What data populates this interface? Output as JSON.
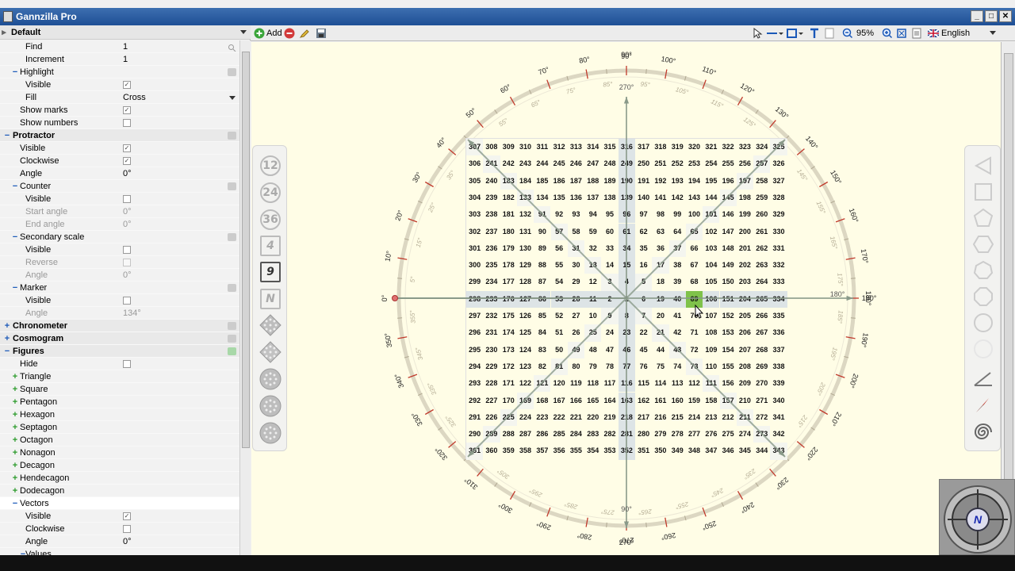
{
  "app": {
    "title": "Gannzilla Pro"
  },
  "profile": {
    "name": "Default"
  },
  "properties": [
    {
      "label": "Find",
      "indent": 2,
      "value": "1",
      "icon": "search"
    },
    {
      "label": "Increment",
      "indent": 2,
      "value": "1"
    },
    {
      "label": "Highlight",
      "indent": 1,
      "toggle": "−",
      "icon": "grid"
    },
    {
      "label": "Visible",
      "indent": 2,
      "check": true
    },
    {
      "label": "Fill",
      "indent": 2,
      "value": "Cross",
      "dropdown": true
    },
    {
      "label": "Show marks",
      "indent": 1,
      "check": true
    },
    {
      "label": "Show numbers",
      "indent": 1,
      "check": false
    },
    {
      "label": "Protractor",
      "indent": 0,
      "toggle": "−",
      "section": true,
      "icon": "protractor"
    },
    {
      "label": "Visible",
      "indent": 1,
      "check": true
    },
    {
      "label": "Clockwise",
      "indent": 1,
      "check": true
    },
    {
      "label": "Angle",
      "indent": 1,
      "value": "0°"
    },
    {
      "label": "Counter",
      "indent": 1,
      "toggle": "−",
      "icon": "counter"
    },
    {
      "label": "Visible",
      "indent": 2,
      "check": false
    },
    {
      "label": "Start angle",
      "indent": 2,
      "value": "0°",
      "dim": true
    },
    {
      "label": "End angle",
      "indent": 2,
      "value": "0°",
      "dim": true
    },
    {
      "label": "Secondary scale",
      "indent": 1,
      "toggle": "−",
      "icon": "scale"
    },
    {
      "label": "Visible",
      "indent": 2,
      "check": false
    },
    {
      "label": "Reverse",
      "indent": 2,
      "check": false,
      "dim": true
    },
    {
      "label": "Angle",
      "indent": 2,
      "value": "0°",
      "dim": true
    },
    {
      "label": "Marker",
      "indent": 1,
      "toggle": "−",
      "icon": "marker"
    },
    {
      "label": "Visible",
      "indent": 2,
      "check": false
    },
    {
      "label": "Angle",
      "indent": 2,
      "value": "134°",
      "dim": true
    },
    {
      "label": "Chronometer",
      "indent": 0,
      "toggle": "+",
      "section": true,
      "icon": "clock"
    },
    {
      "label": "Cosmogram",
      "indent": 0,
      "toggle": "+",
      "section": true,
      "icon": "star"
    },
    {
      "label": "Figures",
      "indent": 0,
      "toggle": "−",
      "section": true,
      "icon": "figures"
    },
    {
      "label": "Hide",
      "indent": 1,
      "check": false
    },
    {
      "label": "Triangle",
      "indent": 1,
      "toggle": "+",
      "green": true
    },
    {
      "label": "Square",
      "indent": 1,
      "toggle": "+",
      "green": true
    },
    {
      "label": "Pentagon",
      "indent": 1,
      "toggle": "+",
      "green": true
    },
    {
      "label": "Hexagon",
      "indent": 1,
      "toggle": "+",
      "green": true
    },
    {
      "label": "Septagon",
      "indent": 1,
      "toggle": "+",
      "green": true
    },
    {
      "label": "Octagon",
      "indent": 1,
      "toggle": "+",
      "green": true
    },
    {
      "label": "Nonagon",
      "indent": 1,
      "toggle": "+",
      "green": true
    },
    {
      "label": "Decagon",
      "indent": 1,
      "toggle": "+",
      "green": true
    },
    {
      "label": "Hendecagon",
      "indent": 1,
      "toggle": "+",
      "green": true
    },
    {
      "label": "Dodecagon",
      "indent": 1,
      "toggle": "+",
      "green": true
    },
    {
      "label": "Vectors",
      "indent": 1,
      "toggle": "−",
      "selected": true
    },
    {
      "label": "Visible",
      "indent": 2,
      "check": true
    },
    {
      "label": "Clockwise",
      "indent": 2,
      "check": false
    },
    {
      "label": "Angle",
      "indent": 2,
      "value": "0°"
    },
    {
      "label": "Values",
      "indent": 2,
      "toggle": "−"
    }
  ],
  "toolbar": {
    "add_label": "Add",
    "zoom": "95%",
    "language": "English"
  },
  "left_tools": {
    "labels": [
      "12",
      "24",
      "36",
      "4",
      "9",
      "N"
    ]
  },
  "square9": {
    "rows": [
      [
        307,
        308,
        309,
        310,
        311,
        312,
        313,
        314,
        315,
        316,
        317,
        318,
        319,
        320,
        321,
        322,
        323,
        324,
        325
      ],
      [
        306,
        241,
        242,
        243,
        244,
        245,
        246,
        247,
        248,
        249,
        250,
        251,
        252,
        253,
        254,
        255,
        256,
        257,
        326
      ],
      [
        305,
        240,
        183,
        184,
        185,
        186,
        187,
        188,
        189,
        190,
        191,
        192,
        193,
        194,
        195,
        196,
        197,
        258,
        327
      ],
      [
        304,
        239,
        182,
        133,
        134,
        135,
        136,
        137,
        138,
        139,
        140,
        141,
        142,
        143,
        144,
        145,
        198,
        259,
        328
      ],
      [
        303,
        238,
        181,
        132,
        91,
        92,
        93,
        94,
        95,
        96,
        97,
        98,
        99,
        100,
        101,
        146,
        199,
        260,
        329
      ],
      [
        302,
        237,
        180,
        131,
        90,
        57,
        58,
        59,
        60,
        61,
        62,
        63,
        64,
        65,
        102,
        147,
        200,
        261,
        330
      ],
      [
        301,
        236,
        179,
        130,
        89,
        56,
        31,
        32,
        33,
        34,
        35,
        36,
        37,
        66,
        103,
        148,
        201,
        262,
        331
      ],
      [
        300,
        235,
        178,
        129,
        88,
        55,
        30,
        13,
        14,
        15,
        16,
        17,
        38,
        67,
        104,
        149,
        202,
        263,
        332
      ],
      [
        299,
        234,
        177,
        128,
        87,
        54,
        29,
        12,
        3,
        4,
        5,
        18,
        39,
        68,
        105,
        150,
        203,
        264,
        333
      ],
      [
        298,
        233,
        176,
        127,
        86,
        53,
        28,
        11,
        2,
        1,
        6,
        19,
        40,
        69,
        106,
        151,
        204,
        265,
        334
      ],
      [
        297,
        232,
        175,
        126,
        85,
        52,
        27,
        10,
        9,
        8,
        7,
        20,
        41,
        70,
        107,
        152,
        205,
        266,
        335
      ],
      [
        296,
        231,
        174,
        125,
        84,
        51,
        26,
        25,
        24,
        23,
        22,
        21,
        42,
        71,
        108,
        153,
        206,
        267,
        336
      ],
      [
        295,
        230,
        173,
        124,
        83,
        50,
        49,
        48,
        47,
        46,
        45,
        44,
        43,
        72,
        109,
        154,
        207,
        268,
        337
      ],
      [
        294,
        229,
        172,
        123,
        82,
        81,
        80,
        79,
        78,
        77,
        76,
        75,
        74,
        73,
        110,
        155,
        208,
        269,
        338
      ],
      [
        293,
        228,
        171,
        122,
        121,
        120,
        119,
        118,
        117,
        116,
        115,
        114,
        113,
        112,
        111,
        156,
        209,
        270,
        339
      ],
      [
        292,
        227,
        170,
        169,
        168,
        167,
        166,
        165,
        164,
        163,
        162,
        161,
        160,
        159,
        158,
        157,
        210,
        271,
        340
      ],
      [
        291,
        226,
        225,
        224,
        223,
        222,
        221,
        220,
        219,
        218,
        217,
        216,
        215,
        214,
        213,
        212,
        211,
        272,
        341
      ],
      [
        290,
        289,
        288,
        287,
        286,
        285,
        284,
        283,
        282,
        281,
        280,
        279,
        278,
        277,
        276,
        275,
        274,
        273,
        342
      ],
      [
        361,
        360,
        359,
        358,
        357,
        356,
        355,
        354,
        353,
        352,
        351,
        350,
        349,
        348,
        347,
        346,
        345,
        344,
        343
      ]
    ],
    "highlighted": 69,
    "axis_labels": {
      "top": "90°",
      "top_inner": "270°",
      "bottom_inner": "90°",
      "bottom": "270°",
      "left": "0°",
      "right_inner": "180°",
      "right": "180°"
    }
  },
  "protractor": {
    "outer_labels": [
      "0°",
      "10°",
      "20°",
      "30°",
      "40°",
      "50°",
      "60°",
      "70°",
      "80°",
      "90°",
      "100°",
      "110°",
      "120°",
      "130°",
      "140°",
      "150°",
      "160°",
      "170°",
      "180°",
      "190°",
      "200°",
      "210°",
      "220°",
      "230°",
      "240°",
      "250°",
      "260°",
      "270°",
      "280°",
      "290°",
      "300°",
      "310°",
      "320°",
      "330°",
      "340°",
      "350°"
    ],
    "inner_labels": [
      "5°",
      "15°",
      "25°",
      "35°",
      "45°",
      "55°",
      "65°",
      "75°",
      "85°",
      "95°",
      "105°",
      "115°",
      "125°",
      "135°",
      "145°",
      "155°",
      "165°",
      "175°",
      "185°",
      "195°",
      "205°",
      "215°",
      "225°",
      "235°",
      "245°",
      "255°",
      "265°",
      "275°",
      "285°",
      "295°",
      "305°",
      "315°",
      "325°",
      "335°",
      "345°",
      "355°"
    ]
  },
  "colors": {
    "canvas": "#fffde6",
    "grid_band": "#dde4e6",
    "highlight": "#7fc24a",
    "ring": "#d8d3c0",
    "tick": "#c0392b",
    "arrow": "#8a9a8a"
  }
}
